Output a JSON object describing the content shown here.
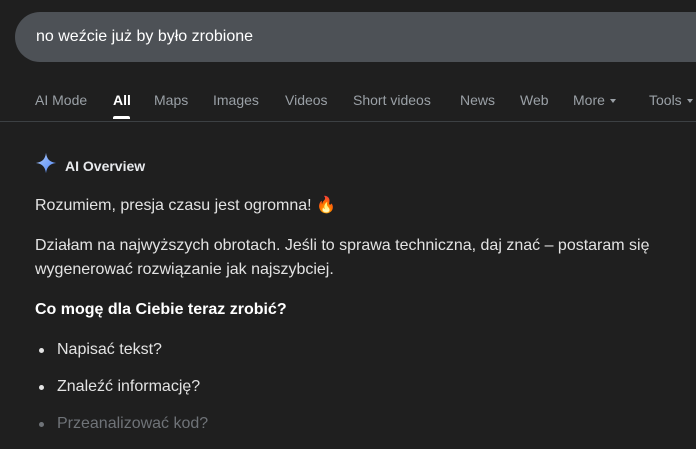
{
  "search": {
    "query": "no weźcie już by było zrobione"
  },
  "tabs": [
    {
      "label": "AI Mode"
    },
    {
      "label": "All"
    },
    {
      "label": "Maps"
    },
    {
      "label": "Images"
    },
    {
      "label": "Videos"
    },
    {
      "label": "Short videos"
    },
    {
      "label": "News"
    },
    {
      "label": "Web"
    },
    {
      "label": "More"
    },
    {
      "label": "Tools"
    }
  ],
  "active_tab": "All",
  "overview": {
    "title": "AI Overview",
    "sparkle_icon": "sparkle-icon",
    "paragraph1": "Rozumiem, presja czasu jest ogromna! 🔥",
    "paragraph2": "Działam na najwyższych obrotach. Jeśli to sprawa techniczna, daj znać – postaram się wygenerować rozwiązanie jak najszybciej.",
    "heading": "Co mogę dla Ciebie teraz zrobić?",
    "items": [
      {
        "label": "Napisać tekst?"
      },
      {
        "label": "Znaleźć informację?"
      },
      {
        "label": "Przeanalizować kod?"
      }
    ]
  },
  "colors": {
    "background": "#1f1f1f",
    "search_bar": "#4d5156",
    "sparkle_blue": "#4f86f7",
    "sparkle_light": "#aecbfa"
  }
}
